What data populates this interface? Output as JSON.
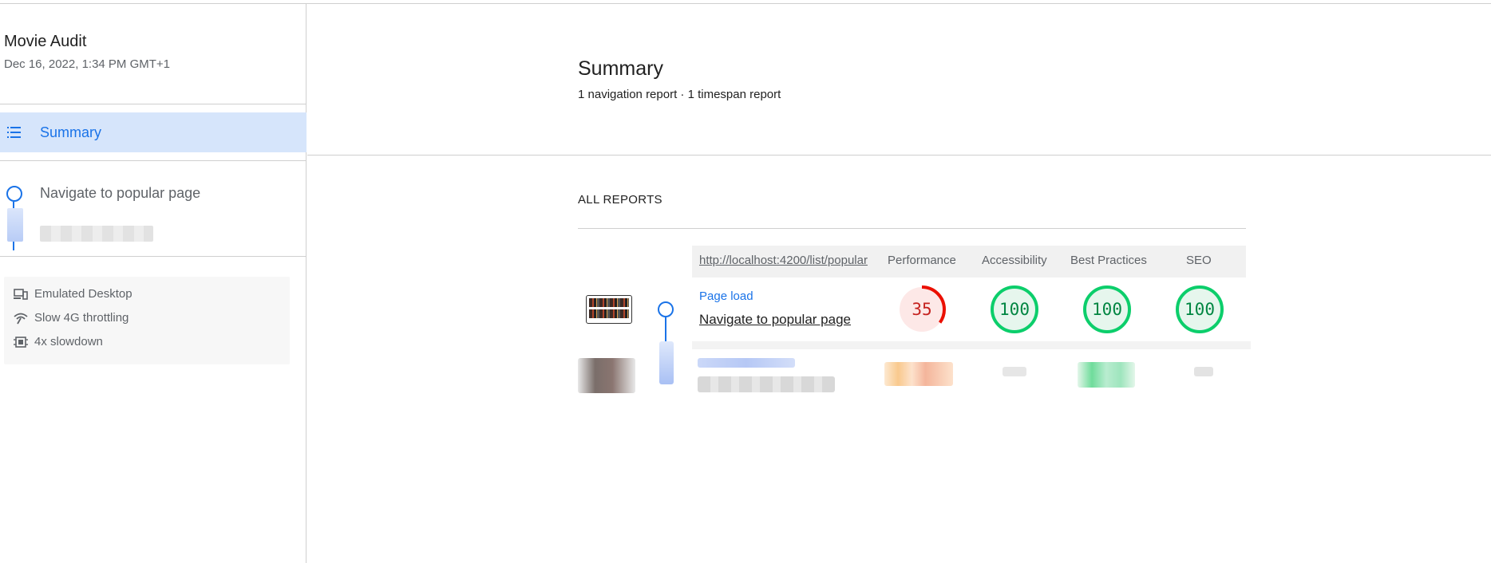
{
  "sidebar": {
    "title": "Movie Audit",
    "date": "Dec 16, 2022, 1:34 PM GMT+1",
    "summary_label": "Summary",
    "step_label": "Navigate to popular page",
    "environment": [
      {
        "icon": "devices-icon",
        "label": "Emulated Desktop"
      },
      {
        "icon": "network-icon",
        "label": "Slow 4G throttling"
      },
      {
        "icon": "cpu-icon",
        "label": "4x slowdown"
      }
    ]
  },
  "main": {
    "title": "Summary",
    "subtitle": "1 navigation report · 1 timespan report",
    "section_label": "ALL REPORTS",
    "table": {
      "url_header": "http://localhost:4200/list/popular",
      "columns": [
        "Performance",
        "Accessibility",
        "Best Practices",
        "SEO"
      ],
      "row": {
        "mode": "Page load",
        "name": "Navigate to popular page",
        "scores": [
          {
            "category": "Performance",
            "value": "35",
            "fraction": 0.35,
            "color": "#eb0f00",
            "bg": "#fde8e7"
          },
          {
            "category": "Accessibility",
            "value": "100",
            "fraction": 1.0,
            "color": "#0cce6b",
            "bg": "#e6f6ed"
          },
          {
            "category": "Best Practices",
            "value": "100",
            "fraction": 1.0,
            "color": "#0cce6b",
            "bg": "#e6f6ed"
          },
          {
            "category": "SEO",
            "value": "100",
            "fraction": 1.0,
            "color": "#0cce6b",
            "bg": "#e6f6ed"
          }
        ]
      }
    }
  },
  "colors": {
    "accent": "#1a73e8",
    "active_bg": "#d6e5fb",
    "fail": "#eb0f00",
    "pass": "#0cce6b",
    "fail_text": "#c5221f",
    "pass_text": "#018642"
  }
}
